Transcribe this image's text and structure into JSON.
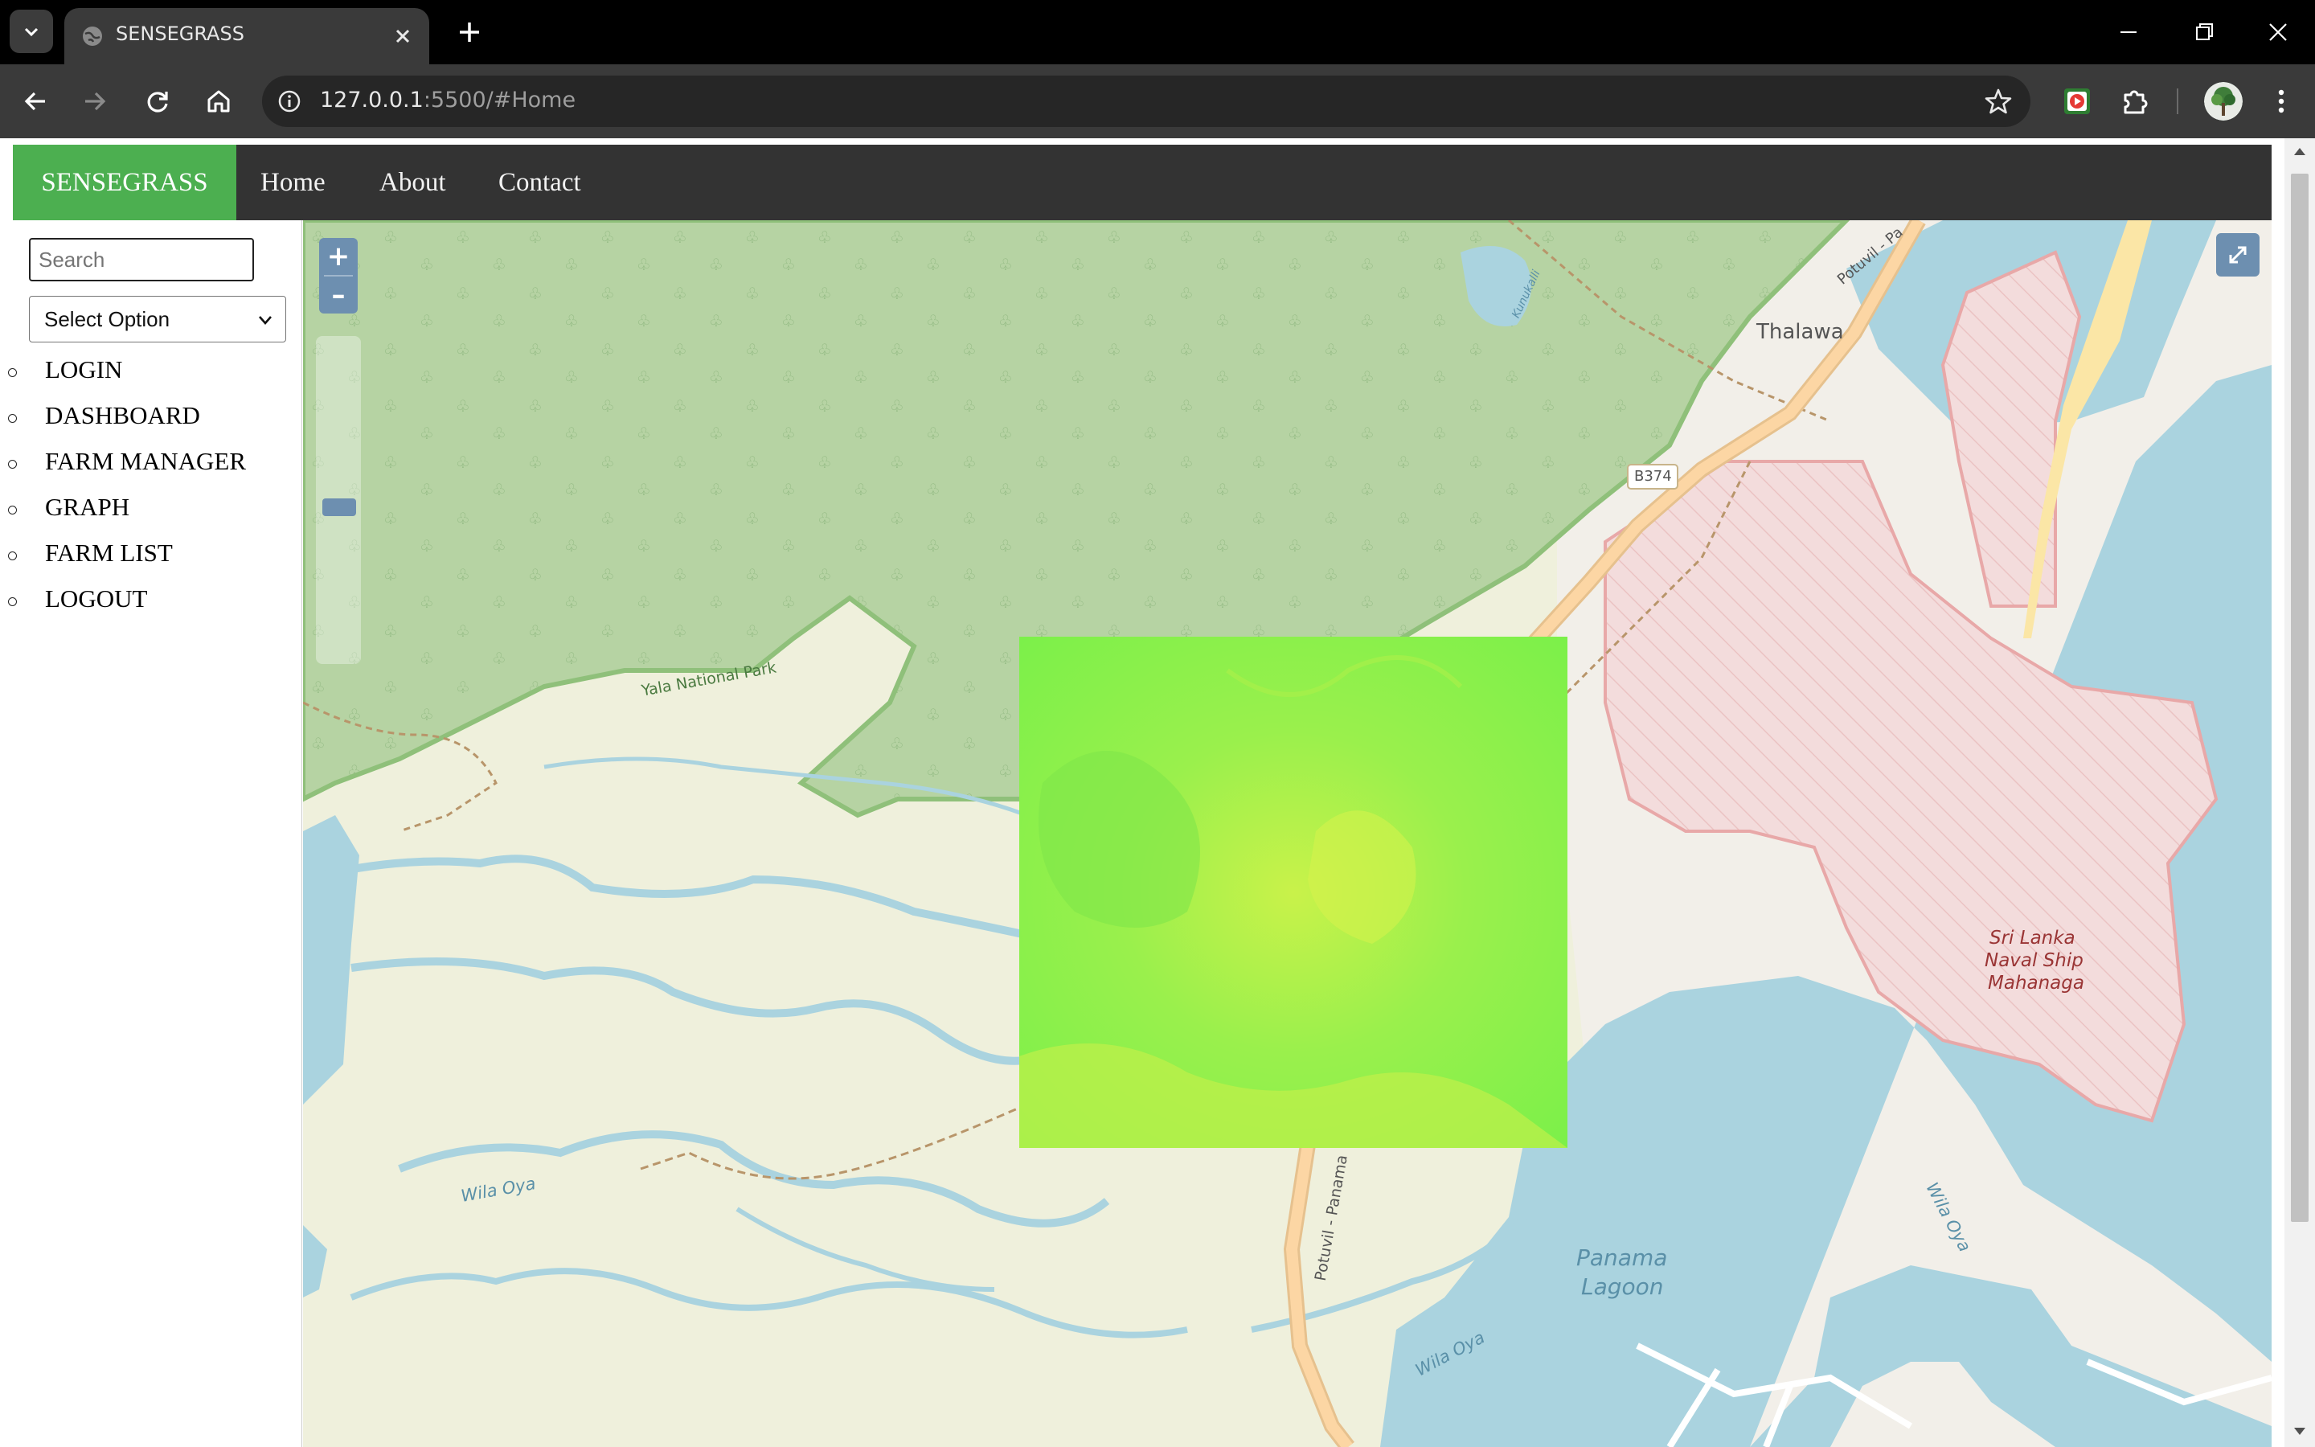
{
  "browser": {
    "tab_title": "SENSEGRASS",
    "url_host": "127.0.0.1",
    "url_rest": ":5500/#Home"
  },
  "nav": {
    "brand": "SENSEGRASS",
    "links": [
      "Home",
      "About",
      "Contact"
    ]
  },
  "sidebar": {
    "search_placeholder": "Search",
    "select_value": "Select Option",
    "menu": [
      "LOGIN",
      "DASHBOARD",
      "FARM MANAGER",
      "GRAPH",
      "FARM LIST",
      "LOGOUT"
    ]
  },
  "map": {
    "labels": {
      "thalawa": "Thalawa",
      "road_b374": "B374",
      "potuvil_top": "Potuvil - Pa",
      "yala": "Yala National Park",
      "wila_oya_1": "Wila Oya",
      "wila_oya_2": "Wila Oya",
      "wila_oya_3": "Wila Oya",
      "potuvil_road": "Potuvil - Panama",
      "panama_1": "Panama",
      "panama_2": "Lagoon",
      "naval_1": "Sri Lanka",
      "naval_2": "Naval Ship",
      "naval_3": "Mahanaga",
      "lake": "Kunukalli"
    },
    "zoom_in": "+",
    "zoom_out": "–",
    "colors": {
      "forest": "#b6d3a3",
      "water": "#aad3df",
      "military": "#f3dcdc",
      "farmland": "#eff0dc",
      "ndvi_overlay": "#8ef24a",
      "control": "#6d8fb0"
    }
  }
}
